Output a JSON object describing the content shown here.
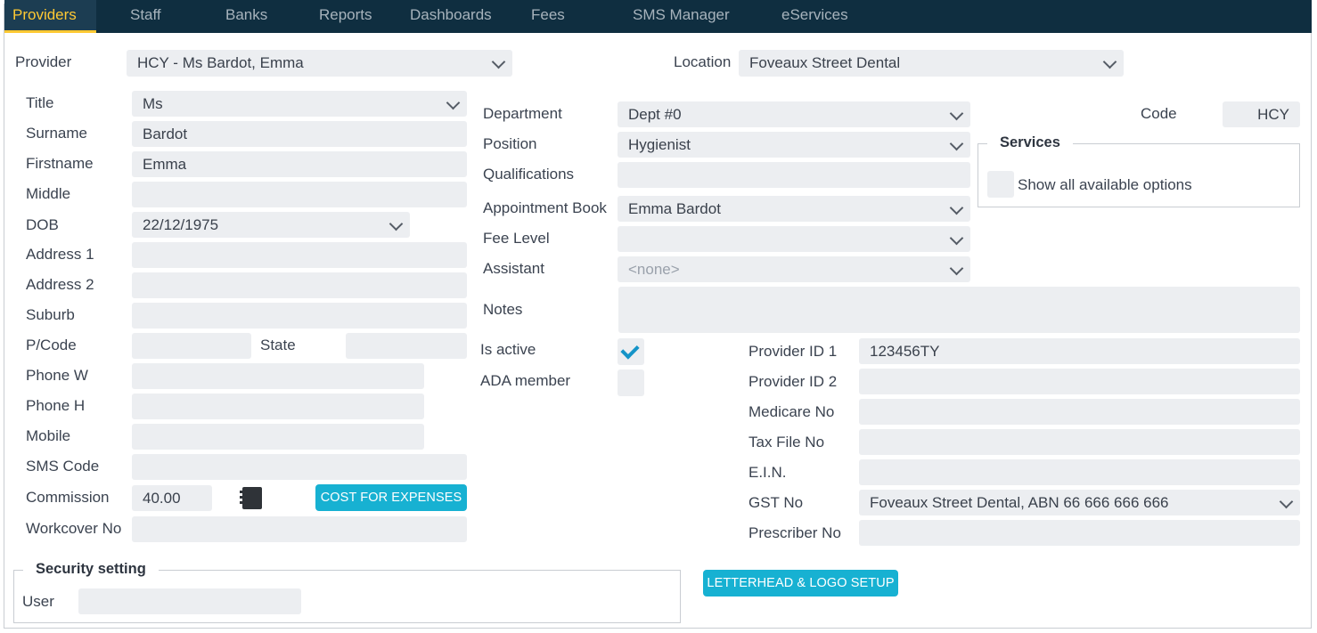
{
  "nav": {
    "tabs": [
      {
        "label": "Providers",
        "active": true
      },
      {
        "label": "Staff"
      },
      {
        "label": "Banks"
      },
      {
        "label": "Reports"
      },
      {
        "label": "Dashboards"
      },
      {
        "label": "Fees"
      },
      {
        "label": "SMS Manager"
      },
      {
        "label": "eServices"
      }
    ]
  },
  "header": {
    "provider_label": "Provider",
    "provider_value": "HCY - Ms Bardot, Emma",
    "location_label": "Location",
    "location_value": "Foveaux Street Dental"
  },
  "personal": {
    "title_label": "Title",
    "title_value": "Ms",
    "surname_label": "Surname",
    "surname_value": "Bardot",
    "firstname_label": "Firstname",
    "firstname_value": "Emma",
    "middle_label": "Middle",
    "middle_value": "",
    "dob_label": "DOB",
    "dob_value": "22/12/1975",
    "address1_label": "Address 1",
    "address1_value": "",
    "address2_label": "Address 2",
    "address2_value": "",
    "suburb_label": "Suburb",
    "suburb_value": "",
    "pcode_label": "P/Code",
    "pcode_value": "",
    "state_label": "State",
    "state_value": "",
    "phonew_label": "Phone W",
    "phonew_value": "",
    "phoneh_label": "Phone H",
    "phoneh_value": "",
    "mobile_label": "Mobile",
    "mobile_value": "",
    "smscode_label": "SMS Code",
    "smscode_value": "",
    "commission_label": "Commission",
    "commission_value": "40.00",
    "cost_button": "COST FOR EXPENSES",
    "workcover_label": "Workcover No",
    "workcover_value": ""
  },
  "work": {
    "department_label": "Department",
    "department_value": "Dept #0",
    "position_label": "Position",
    "position_value": "Hygienist",
    "qualifications_label": "Qualifications",
    "qualifications_value": "",
    "appointment_label": "Appointment Book",
    "appointment_value": "Emma Bardot",
    "feelevel_label": "Fee Level",
    "feelevel_value": "",
    "assistant_label": "Assistant",
    "assistant_value": "<none>",
    "notes_label": "Notes",
    "notes_value": "",
    "code_label": "Code",
    "code_value": "HCY"
  },
  "services": {
    "legend": "Services",
    "show_all_label": "Show all available options",
    "show_all_checked": false
  },
  "status": {
    "is_active_label": "Is active",
    "is_active_checked": true,
    "ada_label": "ADA member",
    "ada_checked": false
  },
  "ids": {
    "provider_id1_label": "Provider ID 1",
    "provider_id1_value": "123456TY",
    "provider_id2_label": "Provider ID 2",
    "provider_id2_value": "",
    "medicare_label": "Medicare No",
    "medicare_value": "",
    "taxfile_label": "Tax File No",
    "taxfile_value": "",
    "ein_label": "E.I.N.",
    "ein_value": "",
    "gst_label": "GST No",
    "gst_value": "Foveaux Street Dental, ABN 66 666 666 666",
    "prescriber_label": "Prescriber No",
    "prescriber_value": ""
  },
  "security": {
    "legend": "Security setting",
    "user_label": "User",
    "user_value": ""
  },
  "letterhead_button": "LETTERHEAD & LOGO SETUP"
}
